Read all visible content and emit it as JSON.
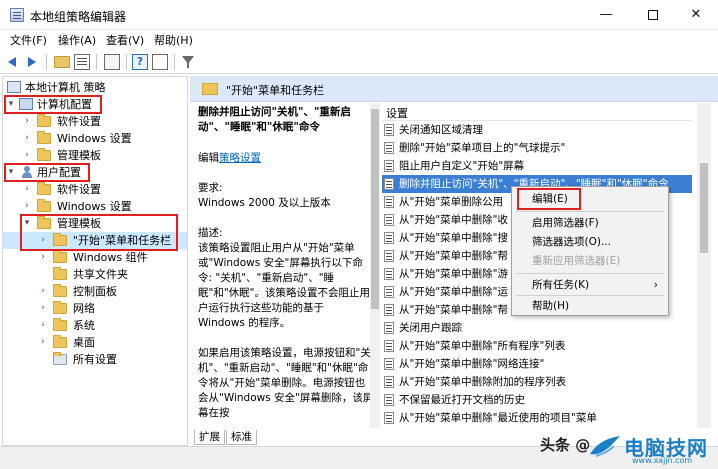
{
  "window": {
    "title": "本地组策略编辑器",
    "minimize": "—",
    "close": "✕"
  },
  "menu": [
    {
      "label": "文件(F)"
    },
    {
      "label": "操作(A)"
    },
    {
      "label": "查看(V)"
    },
    {
      "label": "帮助(H)"
    }
  ],
  "tree": {
    "root": "本地计算机 策略",
    "computer_config": "计算机配置",
    "user_config": "用户配置",
    "items": [
      {
        "label": "软件设置"
      },
      {
        "label": "Windows 设置"
      },
      {
        "label": "管理模板"
      },
      {
        "label": "软件设置"
      },
      {
        "label": "Windows 设置"
      },
      {
        "label": "管理模板"
      },
      {
        "label": "\"开始\"菜单和任务栏"
      },
      {
        "label": "Windows 组件"
      },
      {
        "label": "共享文件夹"
      },
      {
        "label": "控制面板"
      },
      {
        "label": "网络"
      },
      {
        "label": "系统"
      },
      {
        "label": "桌面"
      },
      {
        "label": "所有设置"
      }
    ]
  },
  "header": {
    "title": "\"开始\"菜单和任务栏"
  },
  "description": {
    "title": "删除并阻止访问\"关机\"、\"重新启动\"、\"睡眠\"和\"休眠\"命令",
    "edit_prefix": "编辑",
    "edit_link": "策略设置",
    "requirement_label": "要求:",
    "requirement": "Windows 2000 及以上版本",
    "desc_label": "描述:",
    "desc_text": "该策略设置阻止用户从\"开始\"菜单或\"Windows 安全\"屏幕执行以下命令: \"关机\"、\"重新启动\"、\"睡眠\"和\"休眠\"。该策略设置不会阻止用户运行执行这些功能的基于 Windows 的程序。",
    "enable_text": "如果启用该策略设置，电源按钮和\"关机\"、\"重新启动\"、\"睡眠\"和\"休眠\"命令将从\"开始\"菜单删除。电源按钮也会从\"Windows 安全\"屏幕删除，该屏幕在按"
  },
  "list": {
    "column_title": "设置",
    "rows": [
      {
        "label": "关闭通知区域清理"
      },
      {
        "label": "删除\"开始\"菜单项目上的\"气球提示\""
      },
      {
        "label": "阻止用户自定义\"开始\"屏幕"
      },
      {
        "label": "删除并阻止访问\"关机\"、\"重新启动\"、\"睡眠\"和\"休眠\"命令"
      },
      {
        "label": "从\"开始\"菜单删除公用"
      },
      {
        "label": "从\"开始\"菜单中删除\"收"
      },
      {
        "label": "从\"开始\"菜单中删除\"搜"
      },
      {
        "label": "从\"开始\"菜单中删除\"帮"
      },
      {
        "label": "从\"开始\"菜单中删除\"游"
      },
      {
        "label": "从\"开始\"菜单中删除\"运"
      },
      {
        "label": "从\"开始\"菜单中删除\"帮"
      },
      {
        "label": "关闭用户跟踪"
      },
      {
        "label": "从\"开始\"菜单中删除\"所有程序\"列表"
      },
      {
        "label": "从\"开始\"菜单中删除\"网络连接\""
      },
      {
        "label": "从\"开始\"菜单中删除附加的程序列表"
      },
      {
        "label": "不保留最近打开文档的历史"
      },
      {
        "label": "从\"开始\"菜单中删除\"最近使用的项目\"菜单"
      }
    ]
  },
  "context_menu": {
    "items": [
      {
        "label": "编辑(E)"
      },
      {
        "label": "启用筛选器(F)"
      },
      {
        "label": "筛选器选项(O)..."
      },
      {
        "label": "重新应用筛选器(E)"
      },
      {
        "label": "所有任务(K)",
        "arrow": "›"
      },
      {
        "label": "帮助(H)"
      }
    ]
  },
  "tabs": [
    {
      "label": "扩展"
    },
    {
      "label": "标准"
    }
  ],
  "watermark": {
    "text": "头条 @",
    "brand": "电脑技网",
    "url": "www.xajjn.com"
  }
}
